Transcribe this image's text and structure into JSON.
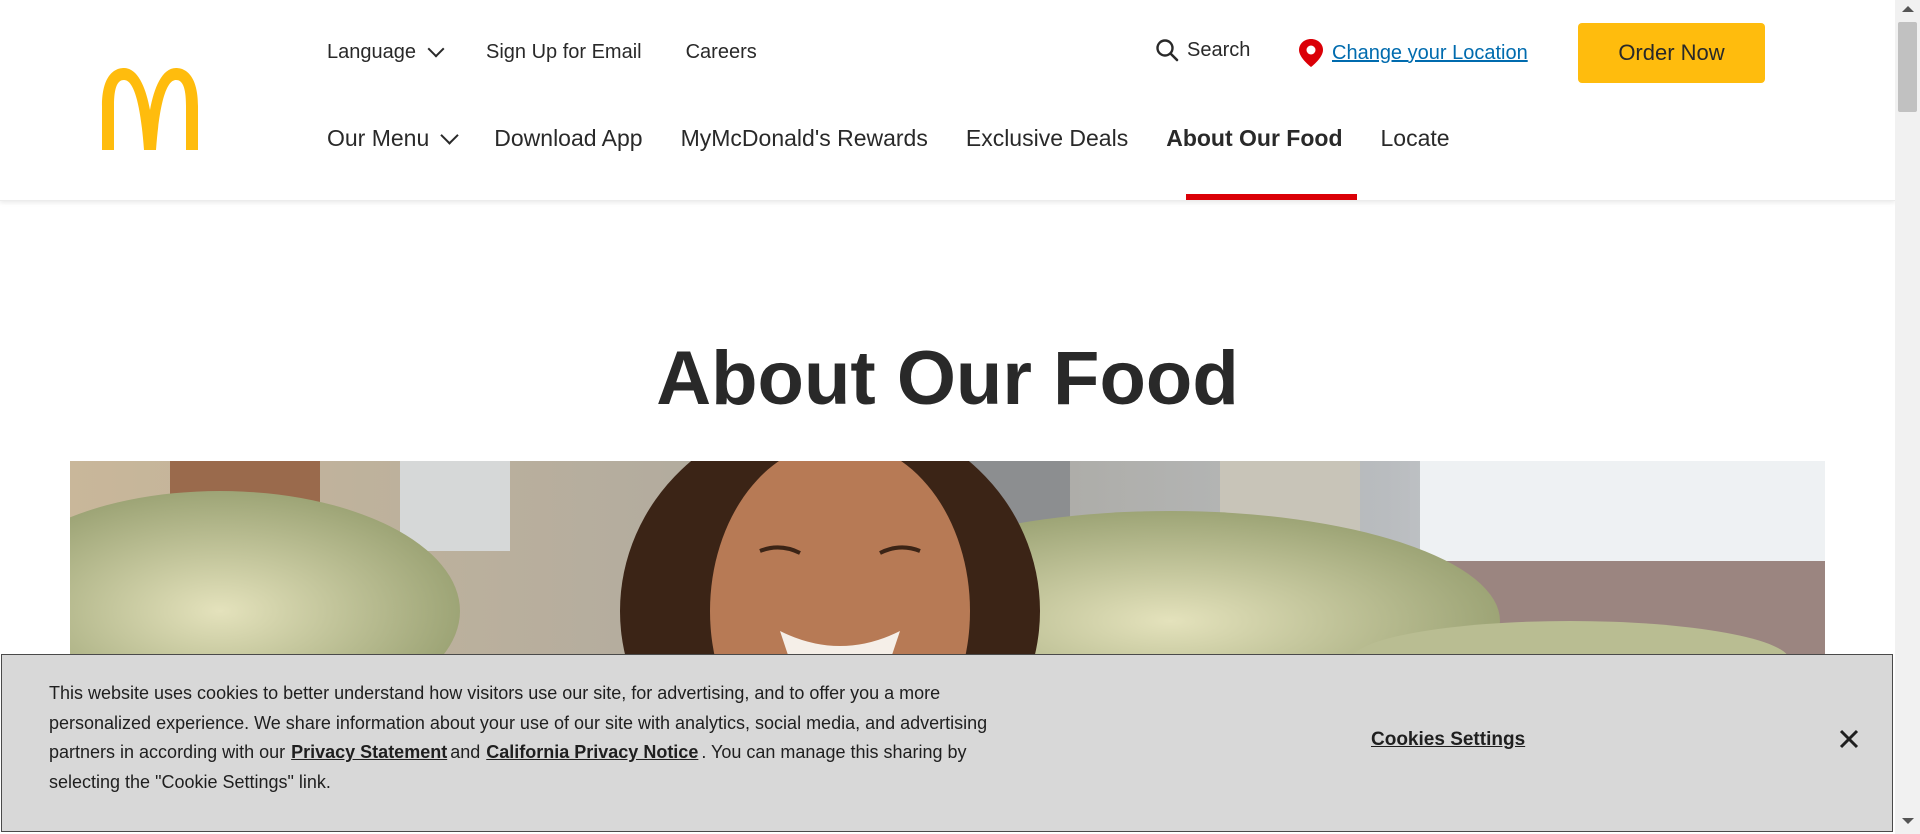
{
  "header": {
    "logo_icon": "golden-arches-logo",
    "util_nav": {
      "language": "Language",
      "signup": "Sign Up for Email",
      "careers": "Careers"
    },
    "search_label": "Search",
    "location_link": "Change your Location",
    "order_button": "Order Now",
    "main_nav": {
      "our_menu": "Our Menu",
      "download_app": "Download App",
      "rewards": "MyMcDonald's Rewards",
      "deals": "Exclusive Deals",
      "about_food": "About Our Food",
      "locate": "Locate"
    },
    "active_tab": "About Our Food"
  },
  "main": {
    "title": "About Our Food"
  },
  "cookie_banner": {
    "text_1": "This website uses cookies to better understand how visitors use our site, for advertising, and to offer you a more personalized experience. We share information about your use of our site with analytics, social media, and advertising partners in according with our",
    "privacy_link": "Privacy Statement",
    "and": "and",
    "california_link": "California Privacy Notice",
    "text_2": ". You can manage this sharing by selecting the \"Cookie Settings\" link.",
    "settings_button": "Cookies Settings",
    "close_icon": "close-icon"
  },
  "colors": {
    "brand_yellow": "#ffbc0d",
    "brand_red": "#db0007",
    "link_blue": "#006bae",
    "text": "#292929",
    "cookie_bg": "#d8d8d8"
  }
}
